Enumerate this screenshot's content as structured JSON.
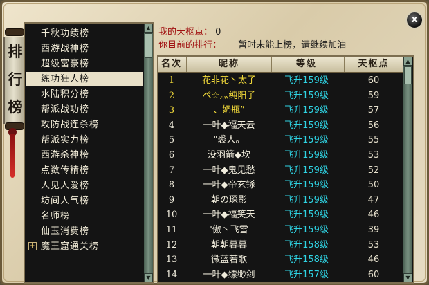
{
  "banner": {
    "title_chars": [
      "排",
      "行",
      "榜"
    ]
  },
  "close_label": "x",
  "categories": [
    {
      "label": "千秋功绩榜",
      "selected": false,
      "expandable": false
    },
    {
      "label": "西游战神榜",
      "selected": false,
      "expandable": false
    },
    {
      "label": "超级富豪榜",
      "selected": false,
      "expandable": false
    },
    {
      "label": "练功狂人榜",
      "selected": true,
      "expandable": false
    },
    {
      "label": "水陆积分榜",
      "selected": false,
      "expandable": false
    },
    {
      "label": "帮派战功榜",
      "selected": false,
      "expandable": false
    },
    {
      "label": "攻防战连杀榜",
      "selected": false,
      "expandable": false
    },
    {
      "label": "帮派实力榜",
      "selected": false,
      "expandable": false
    },
    {
      "label": "西游杀神榜",
      "selected": false,
      "expandable": false
    },
    {
      "label": "点数传精榜",
      "selected": false,
      "expandable": false
    },
    {
      "label": "人见人爱榜",
      "selected": false,
      "expandable": false
    },
    {
      "label": "坊间人气榜",
      "selected": false,
      "expandable": false
    },
    {
      "label": "名师榜",
      "selected": false,
      "expandable": false
    },
    {
      "label": "仙玉消费榜",
      "selected": false,
      "expandable": false
    },
    {
      "label": "魔王窟通关榜",
      "selected": false,
      "expandable": true
    }
  ],
  "expand_icon_glyph": "+",
  "info": {
    "points_label": "我的天枢点：",
    "points_value": "0",
    "rank_label": "你目前的排行：",
    "rank_value": "暂时未能上榜，请继续加油"
  },
  "table": {
    "headers": {
      "rank": "名次",
      "name": "昵称",
      "level": "等级",
      "points": "天枢点"
    },
    "rows": [
      {
        "rank": "1",
        "name": "花非花丶太子",
        "level": "飞升159级",
        "points": "60"
      },
      {
        "rank": "2",
        "name": "ぺ☆灬纯阳子",
        "level": "飞升159级",
        "points": "59"
      },
      {
        "rank": "3",
        "name": "、奶瓶”",
        "level": "飞升159级",
        "points": "57"
      },
      {
        "rank": "4",
        "name": "一叶◆福天云",
        "level": "飞升159级",
        "points": "56"
      },
      {
        "rank": "5",
        "name": "\"裘人。",
        "level": "飞升159级",
        "points": "55"
      },
      {
        "rank": "6",
        "name": "没羽箭◆坎",
        "level": "飞升159级",
        "points": "53"
      },
      {
        "rank": "7",
        "name": "一叶◆鬼见愁",
        "level": "飞升159级",
        "points": "52"
      },
      {
        "rank": "8",
        "name": "一叶◆帝玄铩",
        "level": "飞升159级",
        "points": "50"
      },
      {
        "rank": "9",
        "name": "朝の琛影",
        "level": "飞升159级",
        "points": "47"
      },
      {
        "rank": "10",
        "name": "一叶◆福笑天",
        "level": "飞升159级",
        "points": "46"
      },
      {
        "rank": "11",
        "name": "'傲丶飞雪",
        "level": "飞升159级",
        "points": "39"
      },
      {
        "rank": "12",
        "name": "朝朝暮暮",
        "level": "飞升158级",
        "points": "53"
      },
      {
        "rank": "13",
        "name": "微蓝若歌",
        "level": "飞升158级",
        "points": "46"
      },
      {
        "rank": "14",
        "name": "一叶◆缥缈剑",
        "level": "飞升157级",
        "points": "60"
      }
    ],
    "top_count": 3
  },
  "colors": {
    "highlight": "#f2da3a",
    "level_cyan": "#2fd4e4",
    "label_red": "#a01010"
  }
}
